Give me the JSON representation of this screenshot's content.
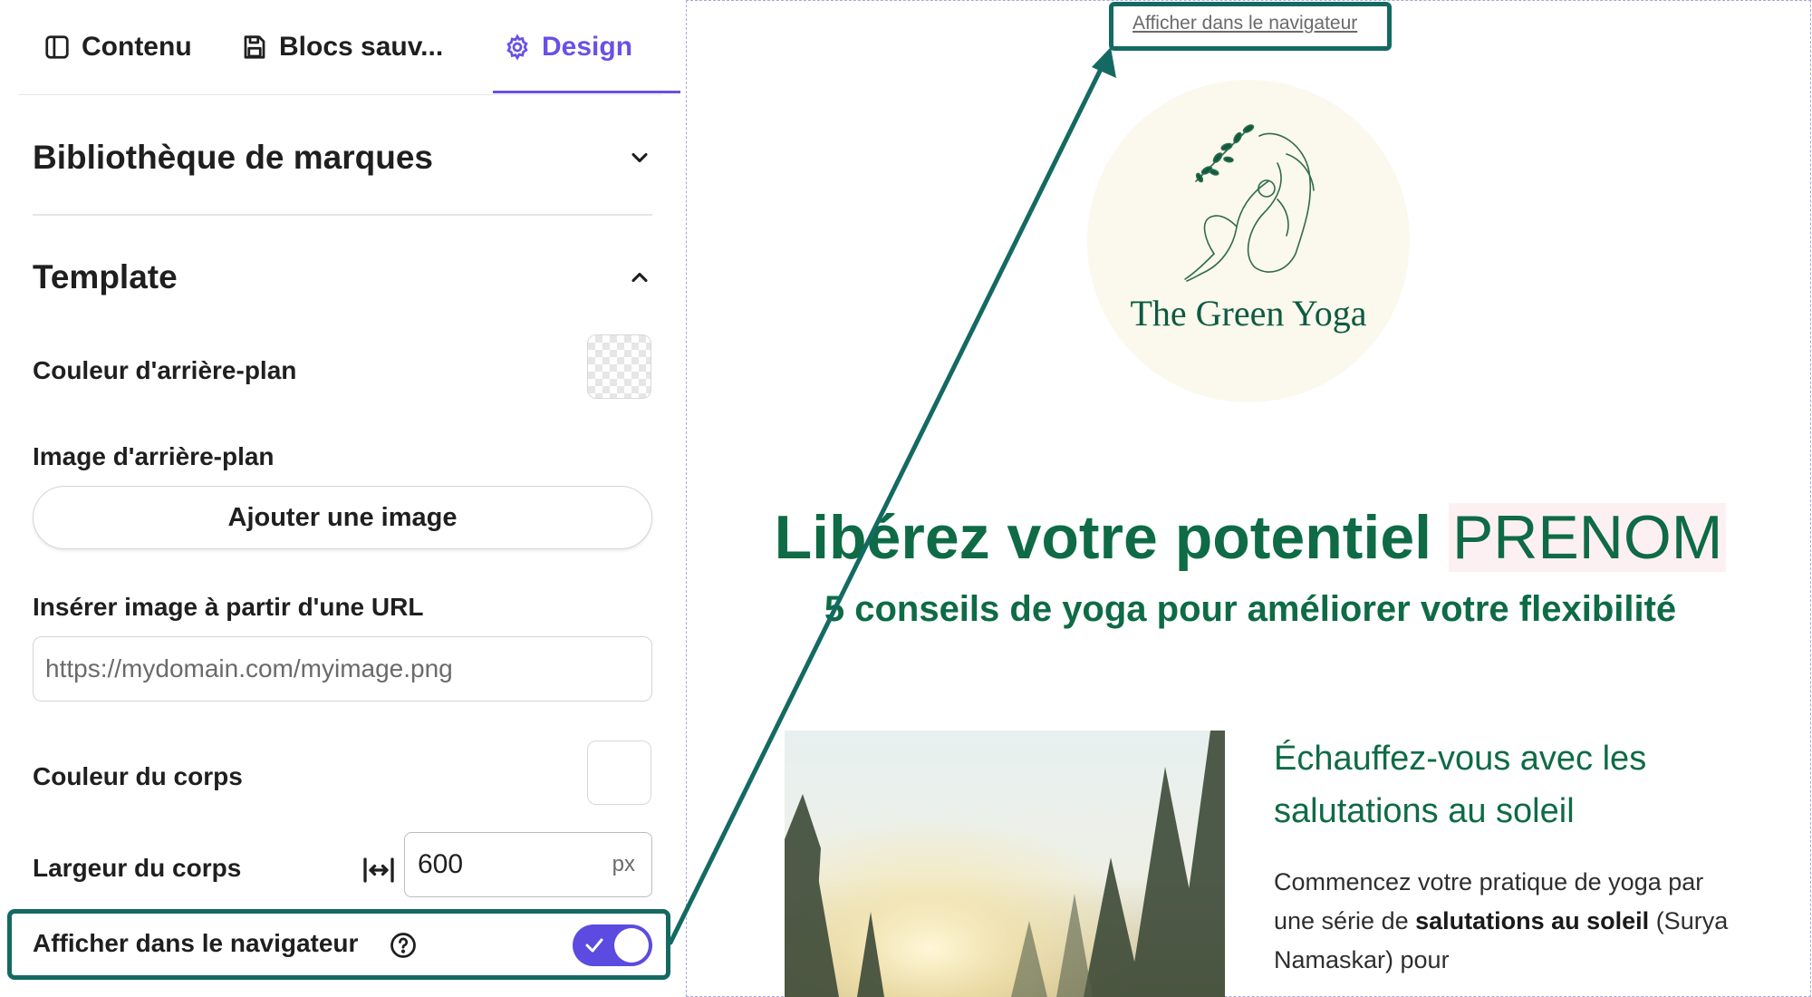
{
  "tabs": [
    {
      "label": "Contenu",
      "icon": "sidebar-panel-icon",
      "active": false
    },
    {
      "label": "Blocs sauv...",
      "icon": "save-disk-icon",
      "active": false
    },
    {
      "label": "Design",
      "icon": "gear-icon",
      "active": true
    }
  ],
  "sections": {
    "brand_library": {
      "title": "Bibliothèque de marques",
      "expanded": false
    },
    "template": {
      "title": "Template",
      "expanded": true
    }
  },
  "fields": {
    "bg_color_label": "Couleur d'arrière-plan",
    "bg_image_label": "Image d'arrière-plan",
    "add_image_button": "Ajouter une image",
    "url_label": "Insérer image à partir d'une URL",
    "url_placeholder": "https://mydomain.com/myimage.png",
    "body_color_label": "Couleur du corps",
    "body_width_label": "Largeur du corps",
    "body_width_value": "600",
    "body_width_unit": "px",
    "browser_label": "Afficher dans le navigateur",
    "browser_toggle_on": true
  },
  "preview": {
    "view_in_browser_link": "Afficher dans le navigateur",
    "logo_text": "The Green Yoga",
    "headline": "Libérez votre potentiel",
    "headline_name": "PRENOM",
    "subheadline": "5 conseils de yoga pour améliorer votre flexibilité",
    "section_title": "Échauffez-vous avec les salutations au soleil",
    "body_part1": "Commencez votre pratique de yoga par une série de ",
    "body_bold1": "salutations au soleil",
    "body_part2": " (Surya Namaskar) pour"
  },
  "colors": {
    "accent": "#6a50e6",
    "toggle": "#5b4be0",
    "annotation": "#146a63",
    "brand_green": "#0e6b45",
    "logo_bg": "#fbf8ee",
    "name_highlight": "#fdf0f3"
  }
}
